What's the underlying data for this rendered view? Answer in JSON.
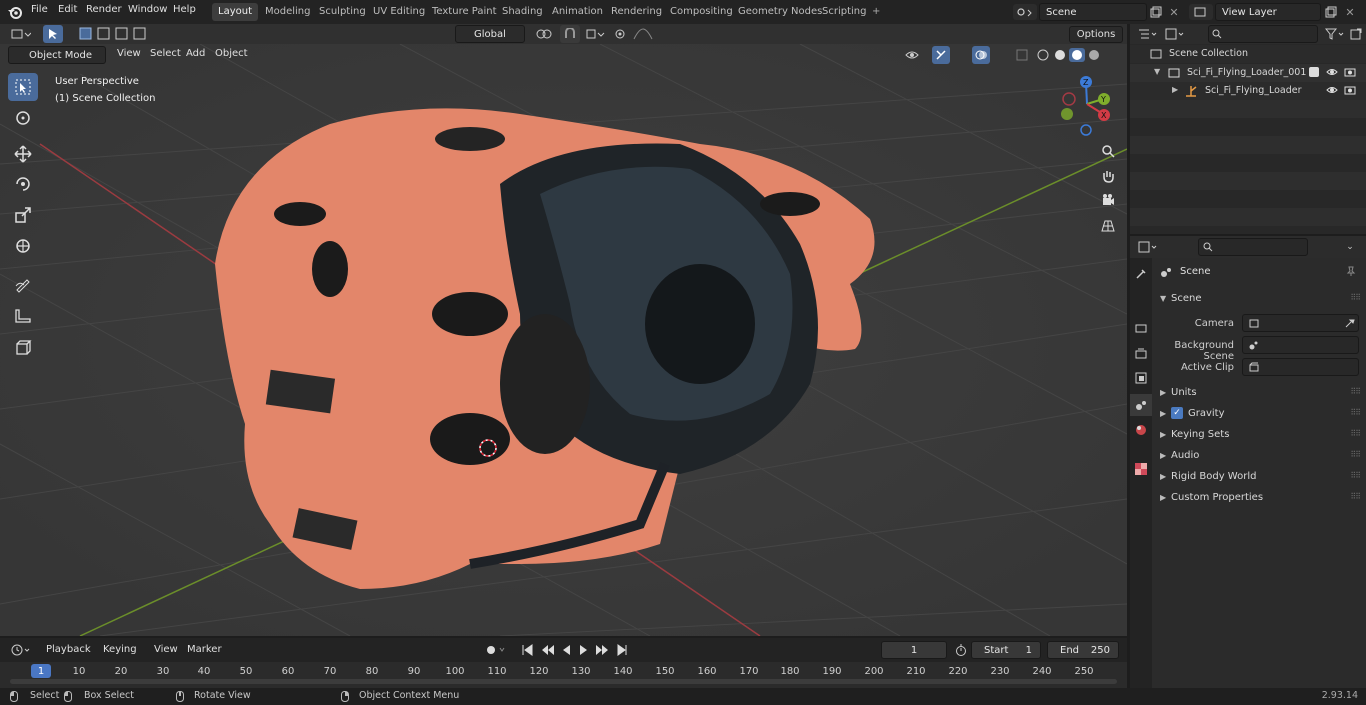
{
  "topbar": {
    "menus": [
      "File",
      "Edit",
      "Render",
      "Window",
      "Help"
    ],
    "workspaces": [
      "Layout",
      "Modeling",
      "Sculpting",
      "UV Editing",
      "Texture Paint",
      "Shading",
      "Animation",
      "Rendering",
      "Compositing",
      "Geometry Nodes",
      "Scripting"
    ],
    "add_tab": "+",
    "scene_name": "Scene",
    "view_layer": "View Layer"
  },
  "tool_header": {
    "transform_orientation": "Global",
    "options": "Options"
  },
  "viewport_header": {
    "mode": "Object Mode",
    "menus": [
      "View",
      "Select",
      "Add",
      "Object"
    ]
  },
  "viewport": {
    "perspective_label": "User Perspective",
    "collection_label": "(1) Scene Collection",
    "gizmo_axes": [
      "Z",
      "Y",
      "X"
    ],
    "colors": {
      "bg": "#393939",
      "x_axis": "#c9454a",
      "y_axis": "#7fae2c",
      "model": "#e3866a"
    }
  },
  "outliner": {
    "root": "Scene Collection",
    "items": [
      {
        "label": "Sci_Fi_Flying_Loader_001"
      },
      {
        "label": "Sci_Fi_Flying_Loader"
      }
    ]
  },
  "properties": {
    "context": "Scene",
    "panel_title": "Scene",
    "fields": {
      "camera": "Camera",
      "background_scene": "Background Scene",
      "active_clip": "Active Clip"
    },
    "sections": [
      "Units",
      "Gravity",
      "Keying Sets",
      "Audio",
      "Rigid Body World",
      "Custom Properties"
    ]
  },
  "timeline": {
    "menus": [
      "Playback",
      "Keying",
      "View",
      "Marker"
    ],
    "current_frame": "1",
    "start_label": "Start",
    "start": "1",
    "end_label": "End",
    "end": "250",
    "ticks": [
      "1",
      "10",
      "20",
      "30",
      "40",
      "50",
      "60",
      "70",
      "80",
      "90",
      "100",
      "110",
      "120",
      "130",
      "140",
      "150",
      "160",
      "170",
      "180",
      "190",
      "200",
      "210",
      "220",
      "230",
      "240",
      "250"
    ]
  },
  "statusbar": {
    "select": "Select",
    "box_select": "Box Select",
    "rotate_view": "Rotate View",
    "context_menu": "Object Context Menu",
    "version": "2.93.14"
  }
}
